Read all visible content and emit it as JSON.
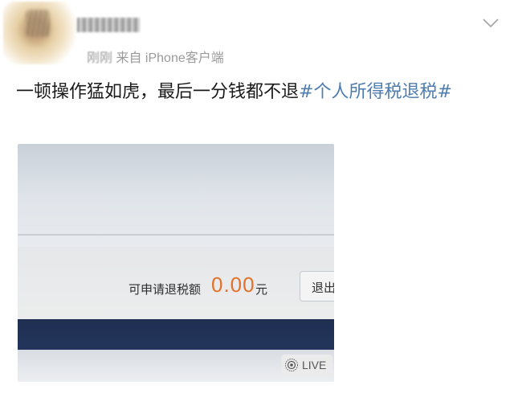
{
  "header": {
    "time_text": "刚刚",
    "source_text": "来自 iPhone客户端"
  },
  "post": {
    "text": "一顿操作猛如虎，最后一分钱都不退",
    "hashtag": "#个人所得税退税#"
  },
  "photo": {
    "refund_label": "可申请退税额",
    "refund_amount": "0.00",
    "refund_unit": "元",
    "logout_button": "退出",
    "live_badge": "LIVE"
  },
  "colors": {
    "hashtag": "#507daf",
    "amount": "#e2722b",
    "meta_gray": "#9a9a9a",
    "navy_bar": "#1f2f52"
  },
  "icons": [
    "chevron-down-icon",
    "live-photo-icon"
  ]
}
